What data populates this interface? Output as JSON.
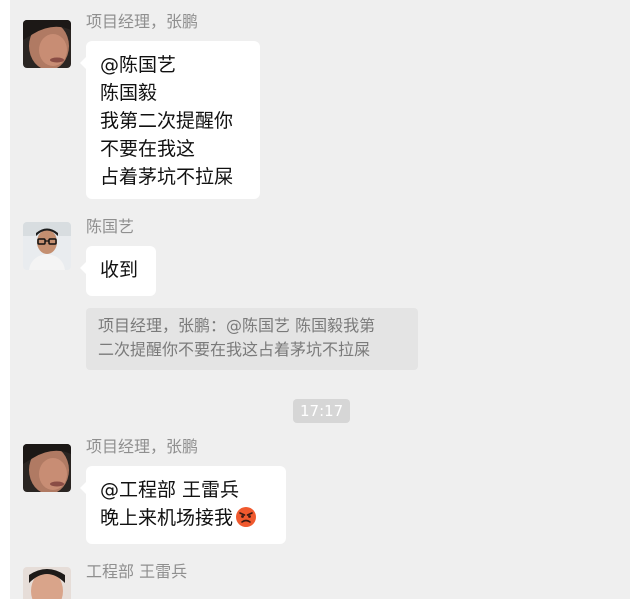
{
  "chat": {
    "messages": [
      {
        "sender": "项目经理，张鹏",
        "lines": [
          "@陈国艺",
          "陈国毅",
          "我第二次提醒你",
          "不要在我这",
          "占着茅坑不拉屎"
        ]
      },
      {
        "sender": "陈国艺",
        "lines": [
          "收到"
        ],
        "quote": {
          "lines": [
            "项目经理，张鹏：@陈国艺 陈国毅我第",
            "二次提醒你不要在我这占着茅坑不拉屎"
          ]
        }
      },
      {
        "time": "17:17"
      },
      {
        "sender": "项目经理，张鹏",
        "lines": [
          "@工程部 王雷兵",
          "晚上来机场接我"
        ],
        "emoji": "angry-face-emoji"
      },
      {
        "sender": "工程部 王雷兵"
      }
    ]
  },
  "colors": {
    "chat_background": "#efefef",
    "bubble": "#ffffff",
    "quote_background": "#e4e4e4",
    "sender_text": "#8f8f8f",
    "time_badge": "#d6d6d6"
  },
  "icons": {
    "avatar_pm": "avatar-pm-icon",
    "avatar_chen": "avatar-chen-icon",
    "avatar_wang": "avatar-wang-icon",
    "emoji": "angry-face-emoji"
  }
}
